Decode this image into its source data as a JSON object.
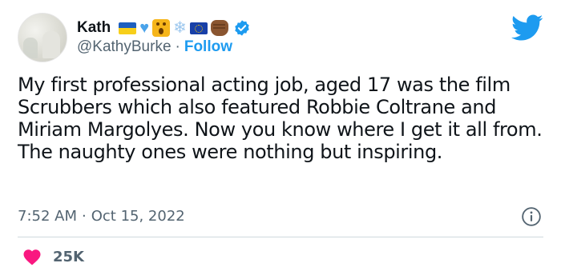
{
  "author": {
    "display_name": "Kath",
    "handle": "@KathyBurke",
    "separator": "·",
    "follow_label": "Follow",
    "emoji_names": [
      "ukraine-flag",
      "blue-heart",
      "face-screaming",
      "snowflake",
      "eu-flag",
      "raised-fist"
    ],
    "verified": true
  },
  "tweet": {
    "text": "My first professional acting job, aged 17 was the film Scrubbers which also featured Robbie Coltrane and Miriam Margolyes. Now you know where I get it all from. The naughty ones were nothing but inspiring."
  },
  "meta": {
    "time": "7:52 AM",
    "separator": "·",
    "date": "Oct 15, 2022"
  },
  "engagement": {
    "likes": "25K"
  },
  "colors": {
    "accent": "#1d9bf0",
    "heart": "#f91880",
    "secondary_text": "#536471",
    "divider": "#cfd9de"
  },
  "icons": {
    "brand": "twitter-bird-icon",
    "info": "info-icon",
    "like": "heart-icon",
    "verified": "verified-badge-icon"
  }
}
